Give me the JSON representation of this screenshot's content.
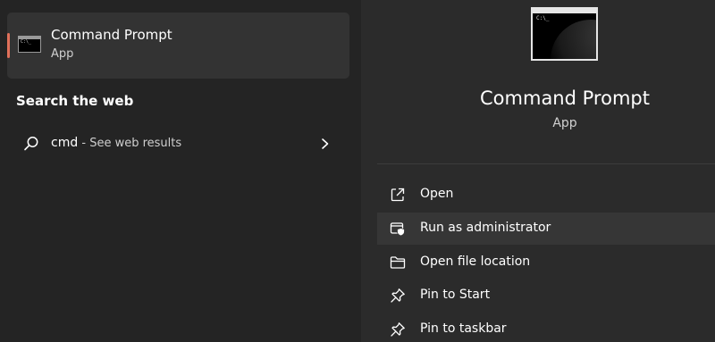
{
  "best_match": {
    "title": "Command Prompt",
    "subtitle": "App",
    "icon": "command-prompt-icon",
    "icon_prompt": "C:\\_"
  },
  "search_web": {
    "heading": "Search the web",
    "query": "cmd",
    "suffix": " - See web results"
  },
  "preview": {
    "title": "Command Prompt",
    "subtitle": "App",
    "icon_prompt": "C:\\_"
  },
  "actions": [
    {
      "label": "Open",
      "icon": "open-external-icon"
    },
    {
      "label": "Run as administrator",
      "icon": "shield-admin-icon"
    },
    {
      "label": "Open file location",
      "icon": "folder-icon"
    },
    {
      "label": "Pin to Start",
      "icon": "pin-icon"
    },
    {
      "label": "Pin to taskbar",
      "icon": "pin-icon"
    }
  ],
  "colors": {
    "accent": "#e0705a",
    "left_background": "#242424",
    "right_background": "#2b2b2b",
    "selected_item": "#333333",
    "hover_item": "#363636"
  }
}
